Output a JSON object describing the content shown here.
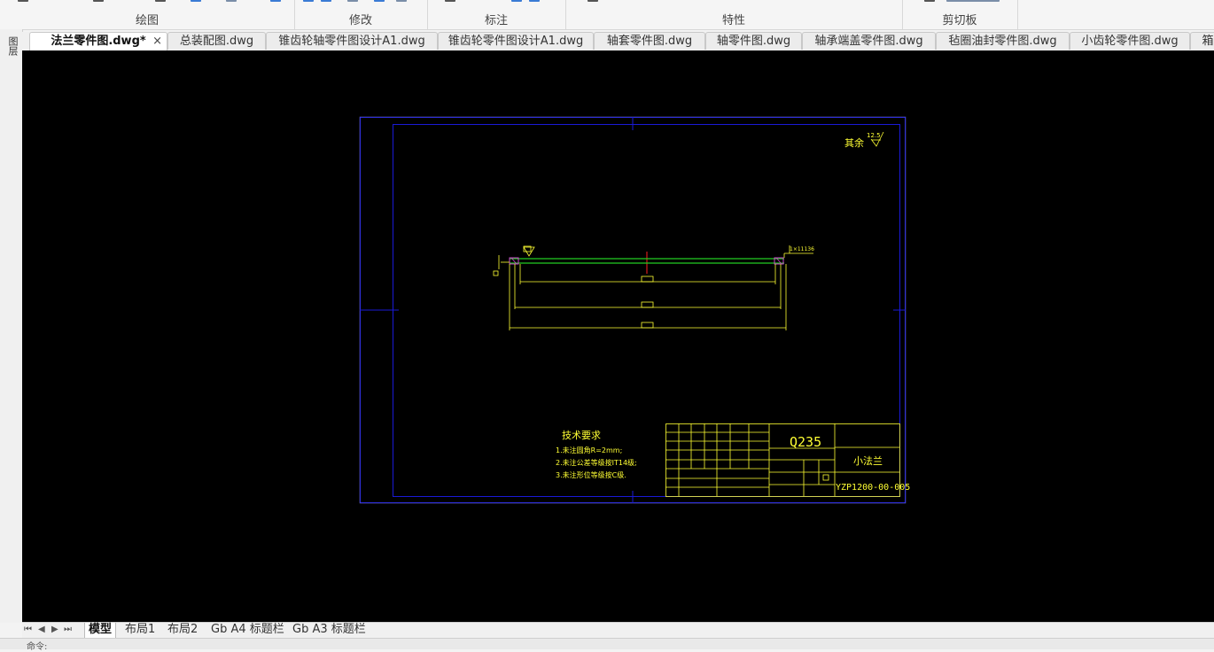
{
  "ribbon": {
    "groups": [
      {
        "label": "绘图"
      },
      {
        "label": "修改"
      },
      {
        "label": "标注"
      },
      {
        "label": "特性"
      },
      {
        "label": "剪切板"
      }
    ]
  },
  "side_strip": {
    "label": "图层"
  },
  "doc_tabs": [
    {
      "label": "法兰零件图.dwg*",
      "active": true
    },
    {
      "label": "总装配图.dwg"
    },
    {
      "label": "锥齿轮轴零件图设计A1.dwg"
    },
    {
      "label": "锥齿轮零件图设计A1.dwg"
    },
    {
      "label": "轴套零件图.dwg"
    },
    {
      "label": "轴零件图.dwg"
    },
    {
      "label": "轴承端盖零件图.dwg"
    },
    {
      "label": "毡圈油封零件图.dwg"
    },
    {
      "label": "小齿轮零件图.dwg"
    },
    {
      "label": "箱"
    }
  ],
  "close_glyph": "×",
  "drawing": {
    "surface_note": "其余",
    "roughness_value": "12.5",
    "tolerance_note": "1×11136",
    "tech_requirements": {
      "title": "技术要求",
      "items": [
        "1.未注圆角R=2mm;",
        "2.未注公差等级按IT14级;",
        "3.未注形位等级按C级."
      ]
    },
    "title_block": {
      "material": "Q235",
      "part_name": "小法兰",
      "drawing_number": "YZP1200-00-005"
    },
    "colors": {
      "frame": "#1a1ad6",
      "lines": "#ffff33",
      "center": "#ff2020",
      "green": "#22cc22",
      "hatch": "#cc44cc"
    }
  },
  "layout_tabs": [
    {
      "label": "模型",
      "active": true
    },
    {
      "label": "布局1"
    },
    {
      "label": "布局2"
    },
    {
      "label": "Gb A4 标题栏"
    },
    {
      "label": "Gb A3 标题栏"
    }
  ],
  "nav_glyphs": [
    "⏮",
    "◀",
    "▶",
    "⏭"
  ],
  "command_line": {
    "prompt": "命令:"
  }
}
